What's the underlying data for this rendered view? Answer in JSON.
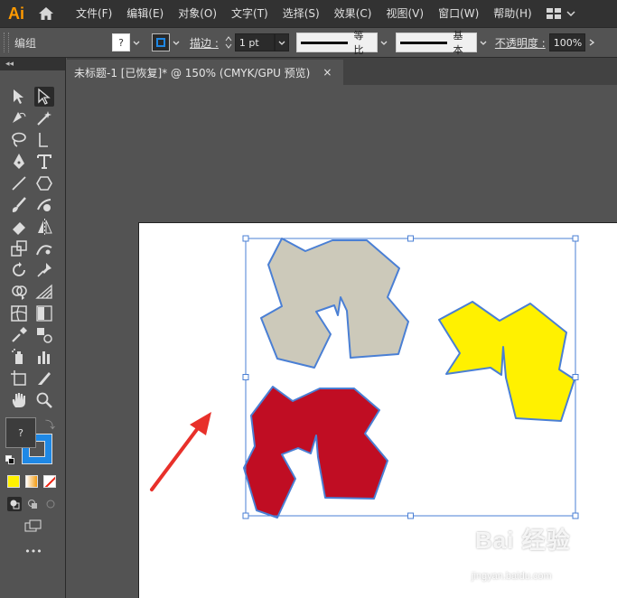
{
  "app": {
    "logo": "Ai"
  },
  "menu": [
    "文件(F)",
    "编辑(E)",
    "对象(O)",
    "文字(T)",
    "选择(S)",
    "效果(C)",
    "视图(V)",
    "窗口(W)",
    "帮助(H)"
  ],
  "control_bar": {
    "selection_label": "编组",
    "fill_value": "?",
    "stroke_label": "描边 :",
    "stroke_weight": "1 pt",
    "variable_width_label": "等比",
    "brush_label": "基本",
    "opacity_label": "不透明度 :",
    "opacity_value": "100%"
  },
  "tools_panel": {
    "collapse_glyph": "◂◂",
    "fill_value": "?",
    "more_tools_glyph": "•••",
    "icons": [
      "selection-tool-icon",
      "direct-selection-tool-icon",
      "curvature-pen-tool-icon",
      "magic-wand-tool-icon",
      "lasso-tool-icon",
      "direct-select-arrow-icon",
      "pen-tool-icon",
      "type-tool-icon",
      "line-segment-tool-icon",
      "polygon-tool-icon",
      "paintbrush-tool-icon",
      "shaper-tool-icon",
      "eraser-tool-icon",
      "reflect-tool-icon",
      "free-transform-tool-icon",
      "puppet-warp-tool-icon",
      "rotate-tool-icon",
      "pin-icon",
      "shape-builder-tool-icon",
      "perspective-grid-tool-icon",
      "mesh-tool-icon",
      "gradient-tool-icon",
      "eyedropper-tool-icon",
      "blend-tool-icon",
      "symbol-sprayer-tool-icon",
      "column-graph-tool-icon",
      "artboard-tool-icon",
      "slice-tool-icon",
      "hand-tool-icon",
      "zoom-tool-icon"
    ]
  },
  "document": {
    "tab_title": "未标题-1 [已恢复]* @ 150% (CMYK/GPU 预览)",
    "close_glyph": "×"
  },
  "artwork": {
    "shapes": [
      {
        "name": "gray-shape",
        "fill": "#ccc9ba"
      },
      {
        "name": "yellow-shape",
        "fill": "#fff100"
      },
      {
        "name": "red-shape",
        "fill": "#c00d23"
      }
    ],
    "selection_color": "#4a7fd4",
    "arrow_color": "#e8302a"
  },
  "watermark": {
    "brand": "Bai 经验",
    "url": "jingyan.baidu.com"
  }
}
